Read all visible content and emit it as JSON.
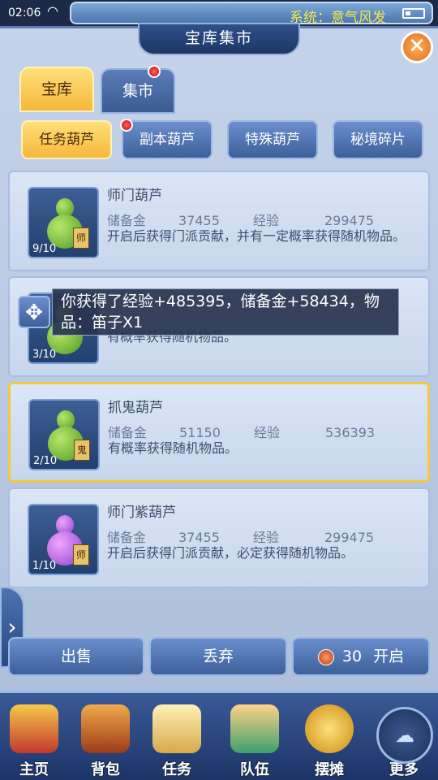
{
  "status": {
    "time": "02:06",
    "system_text": "系统：意气风发"
  },
  "header": {
    "title": "宝库集市",
    "close_label": "✕"
  },
  "tabs": [
    {
      "label": "宝库",
      "active": true
    },
    {
      "label": "集市",
      "active": false
    }
  ],
  "subtabs": [
    {
      "label": "任务葫芦",
      "active": true
    },
    {
      "label": "副本葫芦",
      "active": false
    },
    {
      "label": "特殊葫芦",
      "active": false
    },
    {
      "label": "秘境碎片",
      "active": false
    }
  ],
  "items": [
    {
      "name": "师门葫芦",
      "quantity": "9/10",
      "reserve_label": "储备金",
      "reserve_value": "37455",
      "exp_label": "经验",
      "exp_value": "299475",
      "description": "开启后获得门派贡献，并有一定概率获得随机物品。",
      "tag": "师"
    },
    {
      "name": "",
      "quantity": "3/10",
      "reserve_label": "",
      "reserve_value": "",
      "exp_label": "",
      "exp_value": "",
      "description": "有概率获得随机物品。",
      "tag": ""
    },
    {
      "name": "抓鬼葫芦",
      "quantity": "2/10",
      "reserve_label": "储备金",
      "reserve_value": "51150",
      "exp_label": "经验",
      "exp_value": "536393",
      "description": "有概率获得随机物品。",
      "tag": "鬼"
    },
    {
      "name": "师门紫葫芦",
      "quantity": "1/10",
      "reserve_label": "储备金",
      "reserve_value": "37455",
      "exp_label": "经验",
      "exp_value": "299475",
      "description": "开启后获得门派贡献，必定获得随机物品。",
      "tag": "师"
    }
  ],
  "toast": {
    "text": "你获得了经验+485395，储备金+58434，物品：笛子X1"
  },
  "actions": {
    "sell": "出售",
    "discard": "丢弃",
    "open_count": "30",
    "open": "开启"
  },
  "bottom_nav": [
    {
      "label": "主页",
      "icon": "home-icon"
    },
    {
      "label": "背包",
      "icon": "chest-icon"
    },
    {
      "label": "任务",
      "icon": "scroll-icon"
    },
    {
      "label": "队伍",
      "icon": "team-icon"
    },
    {
      "label": "摆摊",
      "icon": "coin-icon"
    },
    {
      "label": "更多",
      "icon": "more-icon"
    }
  ],
  "colors": {
    "accent": "#f5b73c",
    "panel": "#c4d3e9",
    "nav": "#2a4a82",
    "system_text": "#f7e84a"
  }
}
